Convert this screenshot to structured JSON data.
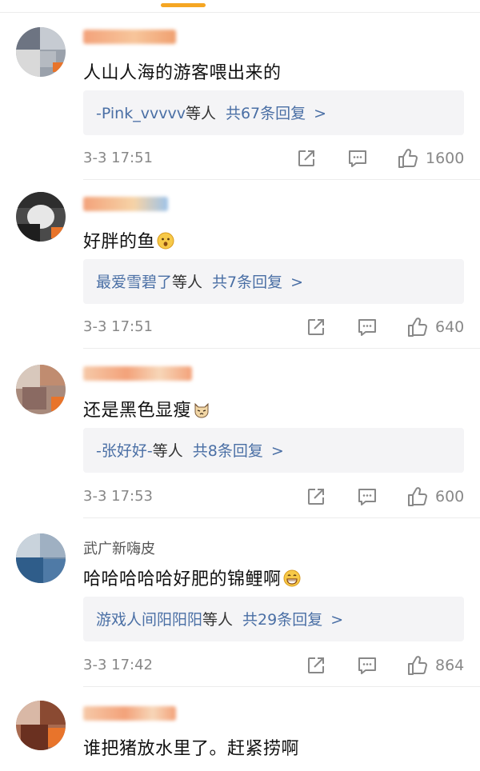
{
  "comments": [
    {
      "name": "",
      "content": "人山人海的游客喂出来的",
      "emoji": "",
      "reply_user": "-Pink_vvvvv",
      "reply_mid": "等人",
      "reply_count": "共67条回复",
      "reply_arrow": ">",
      "time": "3-3 17:51",
      "likes": "1600"
    },
    {
      "name": "",
      "content": "好胖的鱼",
      "emoji": "surprised-face",
      "reply_user": "最爱雪碧了",
      "reply_mid": "等人",
      "reply_count": "共7条回复",
      "reply_arrow": ">",
      "time": "3-3 17:51",
      "likes": "640"
    },
    {
      "name": "",
      "content": "还是黑色显瘦",
      "emoji": "cat-face",
      "reply_user": "-张好好-",
      "reply_mid": "等人",
      "reply_count": "共8条回复",
      "reply_arrow": ">",
      "time": "3-3 17:53",
      "likes": "600"
    },
    {
      "name": "武广新嗨皮",
      "content": "哈哈哈哈哈好肥的锦鲤啊",
      "emoji": "grinning-face",
      "reply_user": "游戏人间阳阳阳",
      "reply_mid": "等人",
      "reply_count": "共29条回复",
      "reply_arrow": ">",
      "time": "3-3 17:42",
      "likes": "864"
    },
    {
      "name": "",
      "content": "谁把猪放水里了。赶紧捞啊",
      "emoji": ""
    }
  ],
  "icons": {
    "share": "share-icon",
    "comment": "comment-icon",
    "like": "thumbs-up-icon"
  },
  "colors": {
    "accent": "#f5a623",
    "link": "#4a6fa5",
    "meta": "#888888",
    "reply_bg": "#f4f4f6"
  }
}
